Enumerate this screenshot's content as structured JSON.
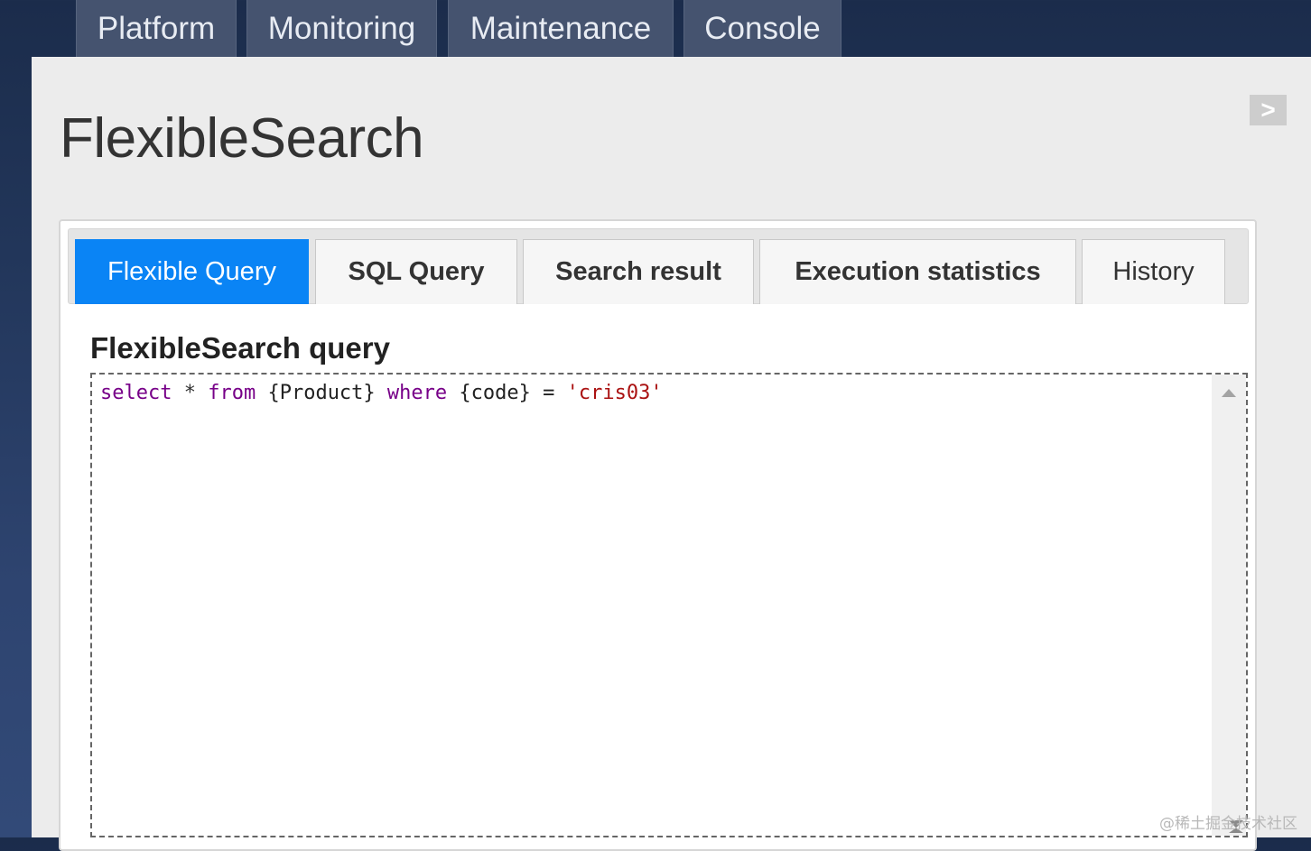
{
  "top_nav": {
    "items": [
      {
        "label": "Platform"
      },
      {
        "label": "Monitoring"
      },
      {
        "label": "Maintenance"
      },
      {
        "label": "Console"
      }
    ]
  },
  "page": {
    "title": "FlexibleSearch",
    "collapse_label": ">"
  },
  "tabs": {
    "items": [
      {
        "label": "Flexible Query",
        "active": true
      },
      {
        "label": "SQL Query"
      },
      {
        "label": "Search result"
      },
      {
        "label": "Execution statistics"
      },
      {
        "label": "History"
      }
    ]
  },
  "query_section": {
    "heading": "FlexibleSearch query",
    "code": {
      "select": "select",
      "star": " * ",
      "from": "from",
      "table": " {Product} ",
      "where": "where",
      "condition": " {code} = ",
      "value": "'cris03'"
    }
  },
  "watermark": "@稀土掘金技术社区",
  "colors": {
    "nav_tab_bg": "#45536f",
    "active_tab": "#0a84f5",
    "keyword": "#770088",
    "string": "#aa1111"
  }
}
